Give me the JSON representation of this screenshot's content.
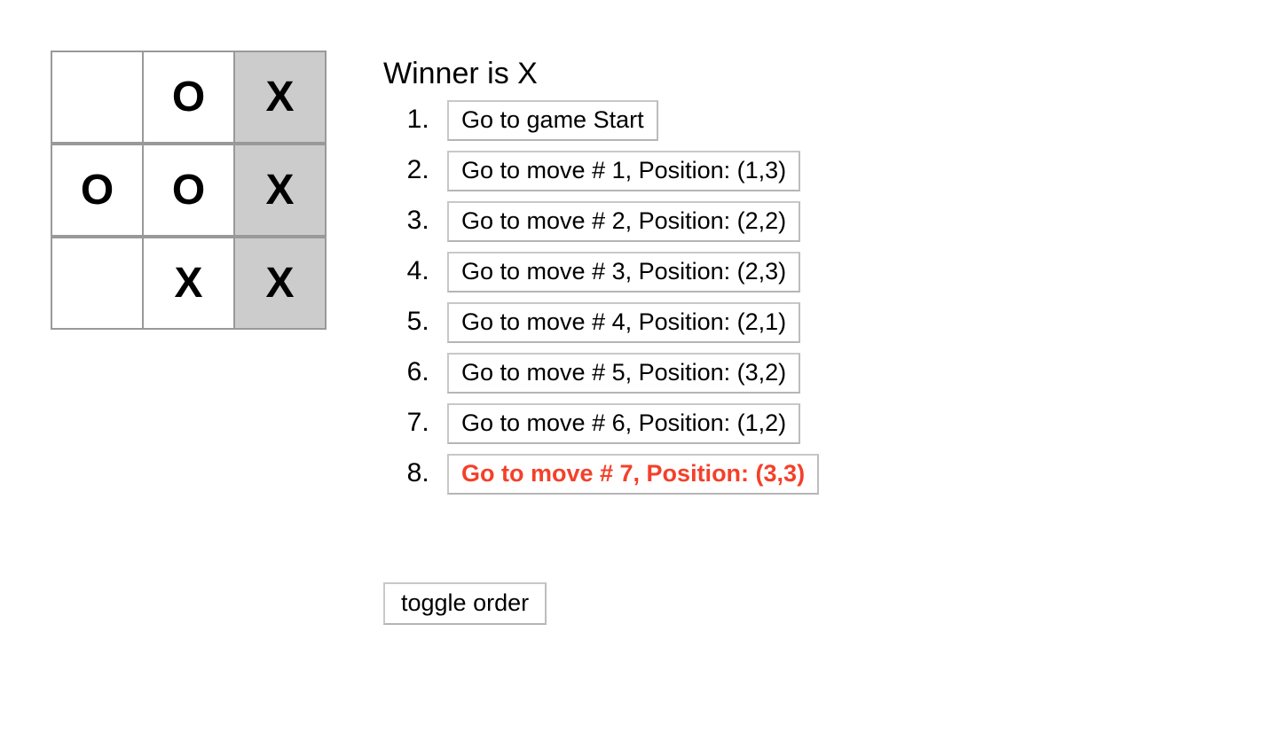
{
  "status": {
    "text": "Winner is X",
    "winner": "X"
  },
  "board": {
    "squares": [
      {
        "value": "",
        "winning": false
      },
      {
        "value": "O",
        "winning": false
      },
      {
        "value": "X",
        "winning": true
      },
      {
        "value": "O",
        "winning": false
      },
      {
        "value": "O",
        "winning": false
      },
      {
        "value": "X",
        "winning": true
      },
      {
        "value": "",
        "winning": false
      },
      {
        "value": "X",
        "winning": false
      },
      {
        "value": "X",
        "winning": true
      }
    ],
    "winning_line_color": "#cccccc",
    "border_color": "#999999"
  },
  "moves": [
    {
      "index": 1,
      "label": "Go to game Start",
      "current": false
    },
    {
      "index": 2,
      "label": "Go to move # 1, Position: (1,3)",
      "current": false
    },
    {
      "index": 3,
      "label": "Go to move # 2, Position: (2,2)",
      "current": false
    },
    {
      "index": 4,
      "label": "Go to move # 3, Position: (2,3)",
      "current": false
    },
    {
      "index": 5,
      "label": "Go to move # 4, Position: (2,1)",
      "current": false
    },
    {
      "index": 6,
      "label": "Go to move # 5, Position: (3,2)",
      "current": false
    },
    {
      "index": 7,
      "label": "Go to move # 6, Position: (1,2)",
      "current": false
    },
    {
      "index": 8,
      "label": "Go to move # 7, Position: (3,3)",
      "current": true
    }
  ],
  "toggle": {
    "label": "toggle order"
  },
  "colors": {
    "current_move": "#f4402a",
    "button_border": "#c8c8c8",
    "text": "#000000",
    "background": "#ffffff"
  }
}
